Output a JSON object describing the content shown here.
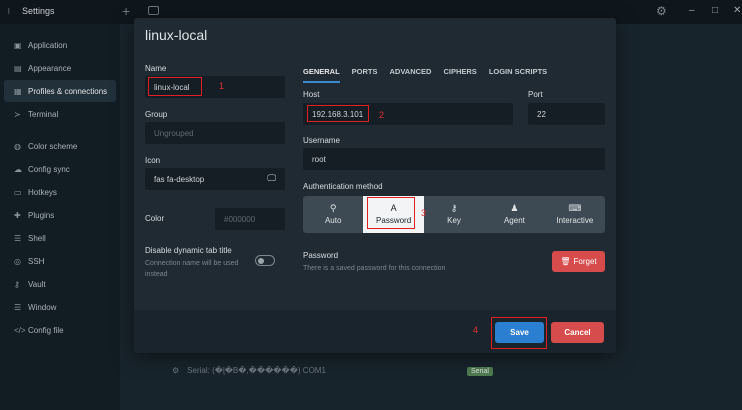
{
  "app": {
    "title": "Settings",
    "logo": "terminal-logo-icon"
  },
  "window_controls": {
    "minimize": "–",
    "maximize": "□",
    "close": "✕"
  },
  "sidebar": {
    "items": [
      {
        "label": "Application",
        "icon": "window-icon",
        "glyph": "▣"
      },
      {
        "label": "Appearance",
        "icon": "image-icon",
        "glyph": "▤"
      },
      {
        "label": "Profiles & connections",
        "icon": "profiles-icon",
        "glyph": "▦",
        "active": true
      },
      {
        "label": "Terminal",
        "icon": "terminal-icon",
        "glyph": "≻"
      },
      {
        "label": "Color scheme",
        "icon": "palette-icon",
        "glyph": "◍"
      },
      {
        "label": "Config sync",
        "icon": "cloud-icon",
        "glyph": "☁"
      },
      {
        "label": "Hotkeys",
        "icon": "keyboard-icon",
        "glyph": "▭"
      },
      {
        "label": "Plugins",
        "icon": "puzzle-icon",
        "glyph": "✚"
      },
      {
        "label": "Shell",
        "icon": "list-icon",
        "glyph": "☰"
      },
      {
        "label": "SSH",
        "icon": "globe-icon",
        "glyph": "◎"
      },
      {
        "label": "Vault",
        "icon": "key-icon",
        "glyph": "⚷"
      },
      {
        "label": "Window",
        "icon": "window-icon",
        "glyph": "☰"
      },
      {
        "label": "Config file",
        "icon": "code-icon",
        "glyph": "</>"
      }
    ]
  },
  "background_list": {
    "serial_label": "Serial: (�ɭ�B�,������)  COM1",
    "badge": "Serial"
  },
  "modal": {
    "title": "linux-local",
    "name_label": "Name",
    "name_value": "linux-local",
    "group_label": "Group",
    "group_placeholder": "Ungrouped",
    "icon_label": "Icon",
    "icon_value": "fas fa-desktop",
    "color_label": "Color",
    "color_placeholder": "#000000",
    "dynamic_title_label": "Disable dynamic tab title",
    "dynamic_title_help": "Connection name will be used instead",
    "tabs": [
      "GENERAL",
      "PORTS",
      "ADVANCED",
      "CIPHERS",
      "LOGIN SCRIPTS"
    ],
    "host_label": "Host",
    "host_value": "192.168.3.101",
    "port_label": "Port",
    "port_value": "22",
    "username_label": "Username",
    "username_value": "root",
    "auth_label": "Authentication method",
    "auth_options": [
      {
        "label": "Auto",
        "icon": "bulb-icon",
        "glyph": "💡"
      },
      {
        "label": "Password",
        "icon": "text-a-icon",
        "glyph": "A",
        "selected": true
      },
      {
        "label": "Key",
        "icon": "key-icon",
        "glyph": "⚷"
      },
      {
        "label": "Agent",
        "icon": "agent-icon",
        "glyph": "♟"
      },
      {
        "label": "Interactive",
        "icon": "keyboard-icon",
        "glyph": "⌨"
      }
    ],
    "password_label": "Password",
    "password_help": "There is a saved password for this connection",
    "forget_label": "Forget",
    "save_label": "Save",
    "cancel_label": "Cancel"
  },
  "annotations": [
    "1",
    "2",
    "3",
    "4"
  ],
  "colors": {
    "accent": "#2b7fd0",
    "danger": "#d64b4b",
    "annotation": "#e02020"
  }
}
